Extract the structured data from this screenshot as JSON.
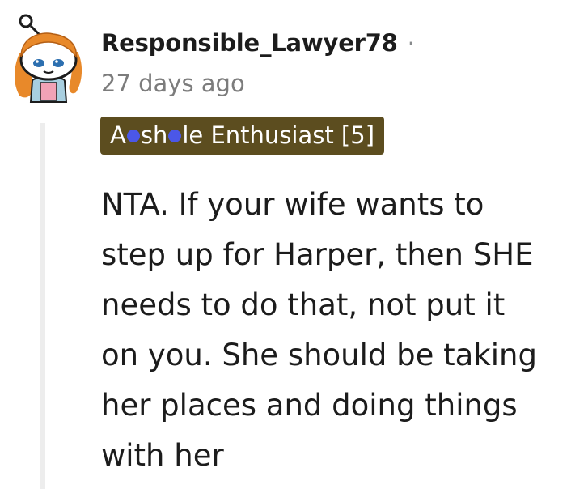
{
  "comment": {
    "author": "Responsible_Lawyer78",
    "separator": "·",
    "timestamp": "27 days ago",
    "flair": {
      "part1": "A",
      "part2": "sh",
      "part3": "le Enthusiast [5]",
      "background": "#5c4d1f",
      "dot_color": "#4b57e8"
    },
    "body_lines": [
      "NTA. If your wife wants to",
      "step up for Harper, then SHE",
      "needs to do that, not put it",
      "on you. She should be taking",
      "her places and doing things",
      "with her"
    ]
  },
  "avatar": {
    "icon": "reddit-snoo-avatar-icon",
    "hair_color": "#e8892a"
  }
}
